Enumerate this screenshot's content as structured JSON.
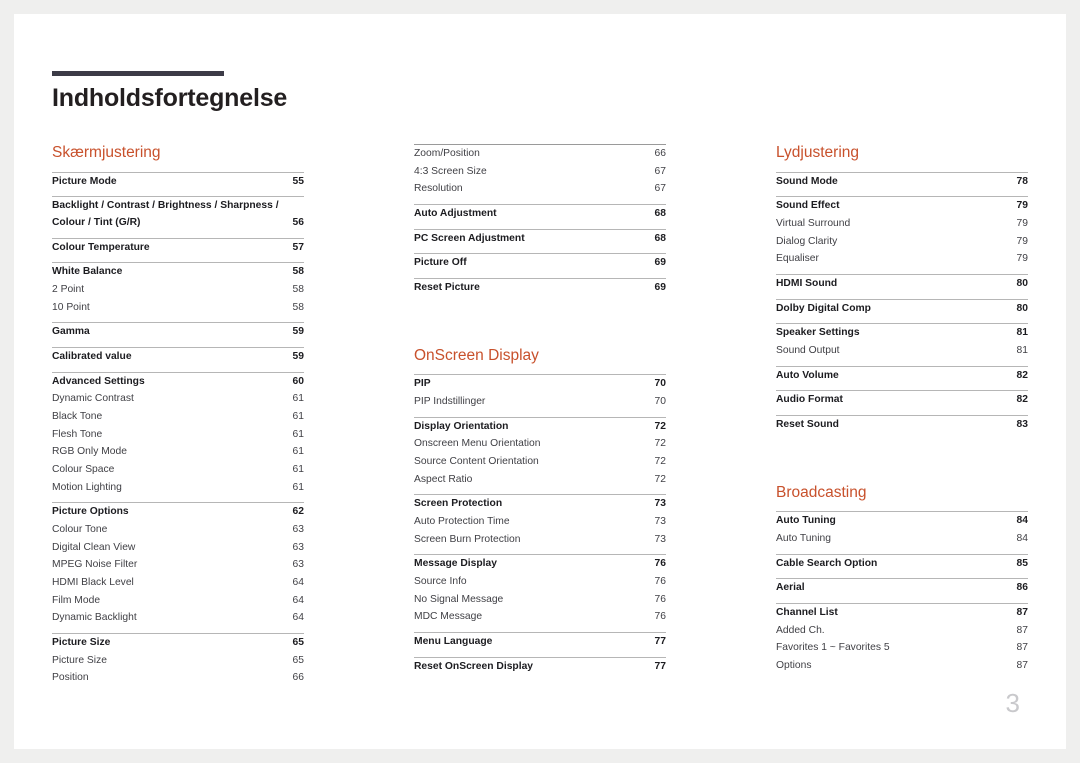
{
  "document": {
    "title": "Indholdsfortegnelse",
    "page_number": "3"
  },
  "colors": {
    "accent": "#c8512c",
    "rule_bar": "#3c3b47",
    "text": "#1c1c20",
    "page_number": "#c9c9cc"
  },
  "columns": [
    {
      "id": "column-1",
      "sections": [
        {
          "heading": "Skærmjustering",
          "groups": [
            {
              "entries": [
                {
                  "label": "Picture Mode",
                  "page": "55",
                  "level": "main"
                }
              ]
            },
            {
              "entries": [
                {
                  "label": "Backlight / Contrast / Brightness / Sharpness /",
                  "label2": "Colour / Tint (G/R)",
                  "page": "56",
                  "level": "main",
                  "wrapped": true
                }
              ]
            },
            {
              "entries": [
                {
                  "label": "Colour Temperature",
                  "page": "57",
                  "level": "main"
                }
              ]
            },
            {
              "entries": [
                {
                  "label": "White Balance",
                  "page": "58",
                  "level": "main"
                },
                {
                  "label": "2 Point",
                  "page": "58",
                  "level": "sub"
                },
                {
                  "label": "10 Point",
                  "page": "58",
                  "level": "sub"
                }
              ]
            },
            {
              "entries": [
                {
                  "label": "Gamma",
                  "page": "59",
                  "level": "main"
                }
              ]
            },
            {
              "entries": [
                {
                  "label": "Calibrated value",
                  "page": "59",
                  "level": "main"
                }
              ]
            },
            {
              "entries": [
                {
                  "label": "Advanced Settings",
                  "page": "60",
                  "level": "main"
                },
                {
                  "label": "Dynamic Contrast",
                  "page": "61",
                  "level": "sub"
                },
                {
                  "label": "Black Tone",
                  "page": "61",
                  "level": "sub"
                },
                {
                  "label": "Flesh Tone",
                  "page": "61",
                  "level": "sub"
                },
                {
                  "label": "RGB Only Mode",
                  "page": "61",
                  "level": "sub"
                },
                {
                  "label": "Colour Space",
                  "page": "61",
                  "level": "sub"
                },
                {
                  "label": "Motion Lighting",
                  "page": "61",
                  "level": "sub"
                }
              ]
            },
            {
              "entries": [
                {
                  "label": "Picture Options",
                  "page": "62",
                  "level": "main"
                },
                {
                  "label": "Colour Tone",
                  "page": "63",
                  "level": "sub"
                },
                {
                  "label": "Digital Clean View",
                  "page": "63",
                  "level": "sub"
                },
                {
                  "label": "MPEG Noise Filter",
                  "page": "63",
                  "level": "sub"
                },
                {
                  "label": "HDMI Black Level",
                  "page": "64",
                  "level": "sub"
                },
                {
                  "label": "Film Mode",
                  "page": "64",
                  "level": "sub"
                },
                {
                  "label": "Dynamic Backlight",
                  "page": "64",
                  "level": "sub"
                }
              ]
            },
            {
              "entries": [
                {
                  "label": "Picture Size",
                  "page": "65",
                  "level": "main"
                },
                {
                  "label": "Picture Size",
                  "page": "65",
                  "level": "sub"
                },
                {
                  "label": "Position",
                  "page": "66",
                  "level": "sub"
                }
              ]
            }
          ]
        }
      ]
    },
    {
      "id": "column-2",
      "sections": [
        {
          "heading": null,
          "groups": [
            {
              "entries": [
                {
                  "label": "Zoom/Position",
                  "page": "66",
                  "level": "sub"
                },
                {
                  "label": "4:3 Screen Size",
                  "page": "67",
                  "level": "sub"
                },
                {
                  "label": "Resolution",
                  "page": "67",
                  "level": "sub"
                }
              ]
            },
            {
              "entries": [
                {
                  "label": "Auto Adjustment",
                  "page": "68",
                  "level": "main"
                }
              ]
            },
            {
              "entries": [
                {
                  "label": "PC Screen Adjustment",
                  "page": "68",
                  "level": "main"
                }
              ]
            },
            {
              "entries": [
                {
                  "label": "Picture Off",
                  "page": "69",
                  "level": "main"
                }
              ]
            },
            {
              "entries": [
                {
                  "label": "Reset Picture",
                  "page": "69",
                  "level": "main"
                }
              ]
            }
          ]
        },
        {
          "heading": "OnScreen Display",
          "groups": [
            {
              "entries": [
                {
                  "label": "PIP",
                  "page": "70",
                  "level": "main"
                },
                {
                  "label": "PIP Indstillinger",
                  "page": "70",
                  "level": "sub"
                }
              ]
            },
            {
              "entries": [
                {
                  "label": "Display Orientation",
                  "page": "72",
                  "level": "main"
                },
                {
                  "label": "Onscreen Menu Orientation",
                  "page": "72",
                  "level": "sub"
                },
                {
                  "label": "Source Content Orientation",
                  "page": "72",
                  "level": "sub"
                },
                {
                  "label": "Aspect Ratio",
                  "page": "72",
                  "level": "sub"
                }
              ]
            },
            {
              "entries": [
                {
                  "label": "Screen Protection",
                  "page": "73",
                  "level": "main"
                },
                {
                  "label": "Auto Protection Time",
                  "page": "73",
                  "level": "sub"
                },
                {
                  "label": "Screen Burn Protection",
                  "page": "73",
                  "level": "sub"
                }
              ]
            },
            {
              "entries": [
                {
                  "label": "Message Display",
                  "page": "76",
                  "level": "main"
                },
                {
                  "label": "Source Info",
                  "page": "76",
                  "level": "sub"
                },
                {
                  "label": "No Signal Message",
                  "page": "76",
                  "level": "sub"
                },
                {
                  "label": "MDC Message",
                  "page": "76",
                  "level": "sub"
                }
              ]
            },
            {
              "entries": [
                {
                  "label": "Menu Language",
                  "page": "77",
                  "level": "main"
                }
              ]
            },
            {
              "entries": [
                {
                  "label": "Reset OnScreen Display",
                  "page": "77",
                  "level": "main"
                }
              ]
            }
          ]
        }
      ]
    },
    {
      "id": "column-3",
      "sections": [
        {
          "heading": "Lydjustering",
          "groups": [
            {
              "entries": [
                {
                  "label": "Sound Mode",
                  "page": "78",
                  "level": "main"
                }
              ]
            },
            {
              "entries": [
                {
                  "label": "Sound Effect",
                  "page": "79",
                  "level": "main"
                },
                {
                  "label": "Virtual Surround",
                  "page": "79",
                  "level": "sub"
                },
                {
                  "label": "Dialog Clarity",
                  "page": "79",
                  "level": "sub"
                },
                {
                  "label": "Equaliser",
                  "page": "79",
                  "level": "sub"
                }
              ]
            },
            {
              "entries": [
                {
                  "label": "HDMI Sound",
                  "page": "80",
                  "level": "main"
                }
              ]
            },
            {
              "entries": [
                {
                  "label": "Dolby Digital Comp",
                  "page": "80",
                  "level": "main"
                }
              ]
            },
            {
              "entries": [
                {
                  "label": "Speaker Settings",
                  "page": "81",
                  "level": "main"
                },
                {
                  "label": "Sound Output",
                  "page": "81",
                  "level": "sub"
                }
              ]
            },
            {
              "entries": [
                {
                  "label": "Auto Volume",
                  "page": "82",
                  "level": "main"
                }
              ]
            },
            {
              "entries": [
                {
                  "label": "Audio Format",
                  "page": "82",
                  "level": "main"
                }
              ]
            },
            {
              "entries": [
                {
                  "label": "Reset Sound",
                  "page": "83",
                  "level": "main"
                }
              ]
            }
          ]
        },
        {
          "heading": "Broadcasting",
          "groups": [
            {
              "entries": [
                {
                  "label": "Auto Tuning",
                  "page": "84",
                  "level": "main"
                },
                {
                  "label": "Auto Tuning",
                  "page": "84",
                  "level": "sub"
                }
              ]
            },
            {
              "entries": [
                {
                  "label": "Cable Search Option",
                  "page": "85",
                  "level": "main"
                }
              ]
            },
            {
              "entries": [
                {
                  "label": "Aerial",
                  "page": "86",
                  "level": "main"
                }
              ]
            },
            {
              "entries": [
                {
                  "label": "Channel List",
                  "page": "87",
                  "level": "main"
                },
                {
                  "label": "Added Ch.",
                  "page": "87",
                  "level": "sub"
                },
                {
                  "label": "Favorites 1 ~ Favorites 5",
                  "page": "87",
                  "level": "sub"
                },
                {
                  "label": "Options",
                  "page": "87",
                  "level": "sub"
                }
              ]
            }
          ]
        }
      ]
    }
  ]
}
